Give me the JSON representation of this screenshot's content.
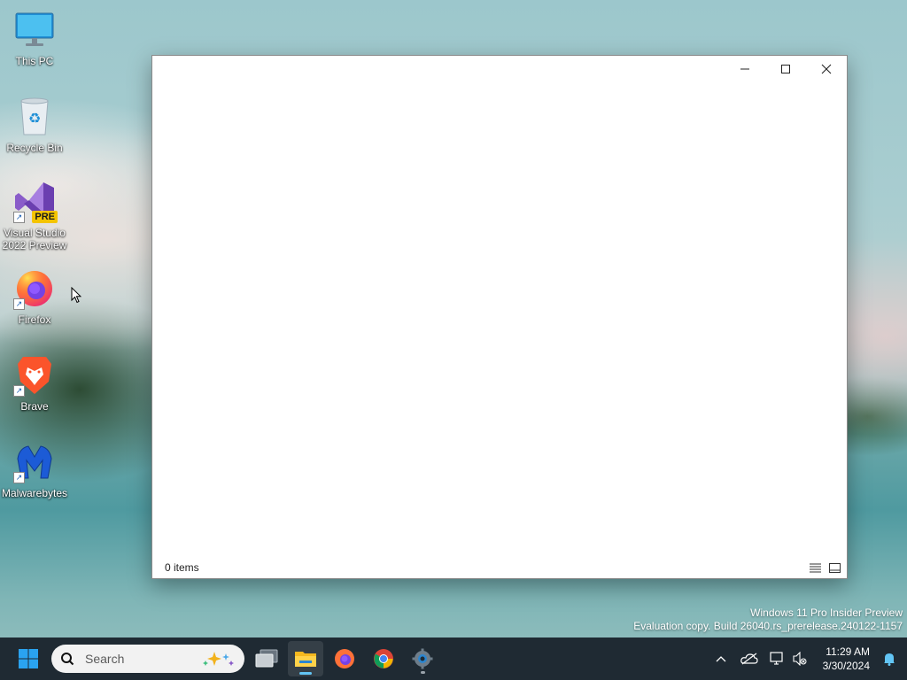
{
  "desktop": {
    "icons": [
      {
        "label": "This PC",
        "icon": "monitor-icon"
      },
      {
        "label": "Recycle Bin",
        "icon": "recycle-bin-icon"
      },
      {
        "label": "Visual Studio 2022 Preview",
        "icon": "visual-studio-icon",
        "badge": "PRE"
      },
      {
        "label": "Firefox",
        "icon": "firefox-icon"
      },
      {
        "label": "Brave",
        "icon": "brave-icon"
      },
      {
        "label": "Malwarebytes",
        "icon": "malwarebytes-icon"
      }
    ]
  },
  "window": {
    "status_text": "0 items",
    "controls": {
      "minimize": "minimize-icon",
      "maximize": "maximize-icon",
      "close": "close-icon"
    },
    "views": [
      "details-view-icon",
      "large-icons-view-icon"
    ]
  },
  "watermark": {
    "line1": "Windows 11 Pro Insider Preview",
    "line2": "Evaluation copy. Build 26040.rs_prerelease.240122-1157"
  },
  "taskbar": {
    "search_placeholder": "Search",
    "apps": [
      "start-icon",
      "task-view-icon",
      "file-explorer-icon",
      "firefox-icon",
      "chrome-icon",
      "settings-icon"
    ],
    "active_app": "file-explorer-icon"
  },
  "tray": {
    "time": "11:29 AM",
    "date": "3/30/2024",
    "icons": [
      "chevron-up-icon",
      "onedrive-icon",
      "network-icon",
      "volume-muted-icon",
      "notification-bell-icon"
    ]
  },
  "colors": {
    "taskbar_bg": "#1f2a33",
    "accent": "#62c5f5",
    "windows_blue": "#2aa3f0"
  }
}
